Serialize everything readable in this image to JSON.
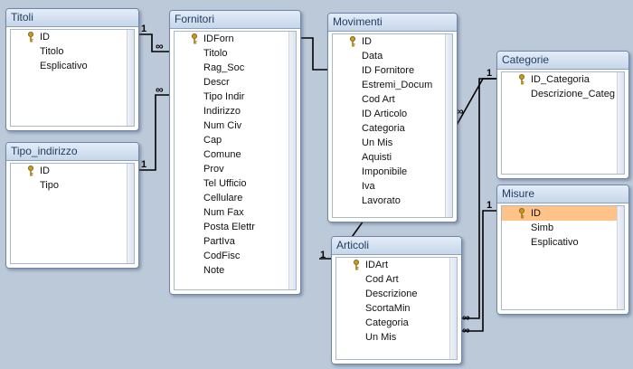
{
  "tables": {
    "titoli": {
      "title": "Titoli",
      "fields": [
        "ID",
        "Titolo",
        "Esplicativo"
      ]
    },
    "tipo_indirizzo": {
      "title": "Tipo_indirizzo",
      "fields": [
        "ID",
        "Tipo"
      ]
    },
    "fornitori": {
      "title": "Fornitori",
      "fields": [
        "IDForn",
        "Titolo",
        "Rag_Soc",
        "Descr",
        "Tipo Indir",
        "Indirizzo",
        "Num Civ",
        "Cap",
        "Comune",
        "Prov",
        "Tel Ufficio",
        "Cellulare",
        "Num Fax",
        "Posta Elettr",
        "PartIva",
        "CodFisc",
        "Note"
      ]
    },
    "movimenti": {
      "title": "Movimenti",
      "fields": [
        "ID",
        "Data",
        "ID Fornitore",
        "Estremi_Docum",
        "Cod Art",
        "ID Articolo",
        "Categoria",
        "Un Mis",
        "Aquisti",
        "Imponibile",
        "Iva",
        "Lavorato"
      ]
    },
    "categorie": {
      "title": "Categorie",
      "fields": [
        "ID_Categoria",
        "Descrizione_Categ"
      ]
    },
    "misure": {
      "title": "Misure",
      "fields": [
        "ID",
        "Simb",
        "Esplicativo"
      ]
    },
    "articoli": {
      "title": "Articoli",
      "fields": [
        "IDArt",
        "Cod Art",
        "Descrizione",
        "ScortaMin",
        "Categoria",
        "Un Mis"
      ]
    }
  },
  "relationships": {
    "one_label": "1",
    "many_label": "∞"
  },
  "colors": {
    "canvas": "#bcc9d9",
    "table_header": "#c6d6ea",
    "selected_field": "#ffc38a",
    "key": "#c79a1c"
  }
}
